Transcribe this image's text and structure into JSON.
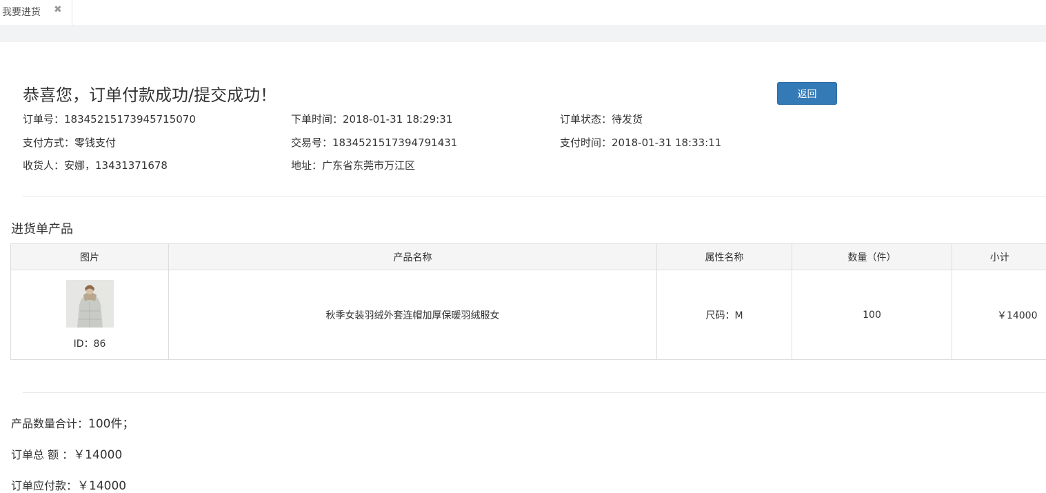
{
  "tab": {
    "label": "我要进货",
    "close": "✖"
  },
  "header": {
    "title": "恭喜您，订单付款成功/提交成功！",
    "back_label": "返回"
  },
  "order": {
    "order_no": "订单号：18345215173945715070",
    "order_time": "下单时间：2018-01-31 18:29:31",
    "status": "订单状态：待发货",
    "pay_method": "支付方式：零钱支付",
    "trade_no": "交易号：183452151739479143​1",
    "pay_time": "支付时间：2018-01-31 18:33:11",
    "receiver": "收货人：安娜，13431371678",
    "address": "地址：广东省东莞市万江区"
  },
  "products": {
    "section_title": "进货单产品",
    "columns": [
      "图片",
      "产品名称",
      "属性名称",
      "数量（件）",
      "小计"
    ],
    "rows": [
      {
        "id": "ID：86",
        "name": "秋季女装羽绒外套连帽加厚保暖羽绒服女",
        "attr": "尺码：M",
        "qty": "100",
        "subtotal": "￥14000"
      }
    ]
  },
  "summary": {
    "qty_label": "产品数量合计：",
    "qty_value": "100件；",
    "total_label": "订单总 额 ：",
    "total_value": "￥14000",
    "payable_label": "订单应付款：",
    "payable_value": "￥14000"
  },
  "colors": {
    "primary": "#337ab7",
    "header_bg": "#f5f5f5",
    "border": "#dddddd"
  }
}
